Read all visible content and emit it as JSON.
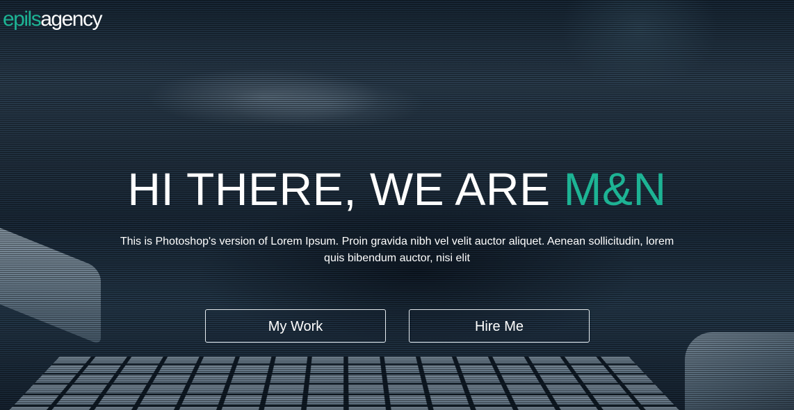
{
  "brand": {
    "logo_part1": "epils",
    "logo_part2": "agency",
    "accent_color": "#1db394"
  },
  "hero": {
    "headline_main": "HI THERE, WE ARE ",
    "headline_accent": "M&N",
    "subtitle": "This is Photoshop's version of Lorem Ipsum. Proin gravida nibh vel velit auctor aliquet. Aenean sollicitudin, lorem quis bibendum auctor, nisi elit",
    "buttons": [
      {
        "label": "My Work"
      },
      {
        "label": "Hire Me"
      }
    ]
  }
}
